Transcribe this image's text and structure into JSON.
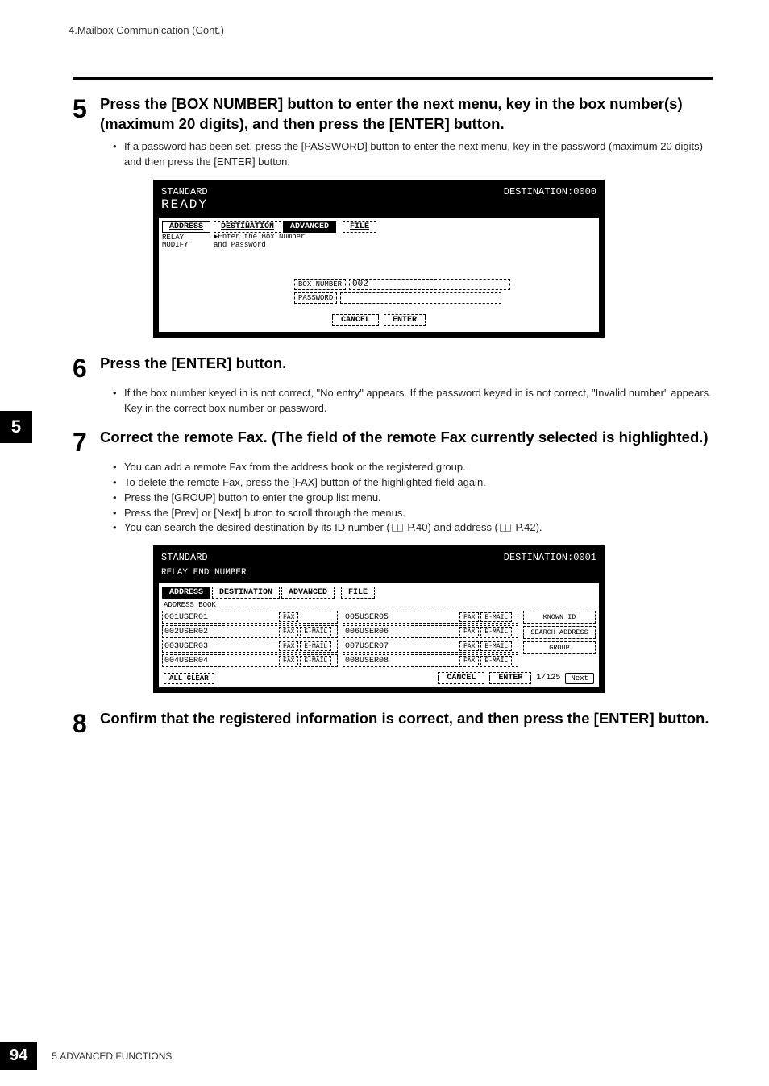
{
  "header": {
    "breadcrumb": "4.Mailbox Communication (Cont.)"
  },
  "chapter_tab": "5",
  "steps": {
    "s5": {
      "num": "5",
      "title": "Press the [BOX NUMBER] button to enter the next menu, key in the box number(s) (maximum 20 digits), and then press the [ENTER] button.",
      "bullets": [
        "If a password has been set, press the [PASSWORD] button to enter the next menu, key in the password (maximum 20 digits) and then press the [ENTER] button."
      ]
    },
    "s6": {
      "num": "6",
      "title": "Press the [ENTER] button.",
      "bullets": [
        "If the box number keyed in is not correct, \"No entry\" appears. If the password keyed in is not correct, \"Invalid number\" appears. Key in the correct box number or password."
      ]
    },
    "s7": {
      "num": "7",
      "title": "Correct the remote Fax. (The field of the remote Fax currently selected is highlighted.)",
      "bullets": [
        "You can add a remote Fax from the address book or the registered group.",
        "To delete the remote Fax, press the [FAX] button of the highlighted field again.",
        "Press the [GROUP] button to enter the group list menu.",
        "Press the [Prev] or [Next] button to scroll through the menus."
      ],
      "bullet_with_refs": {
        "prefix": "You can search the desired destination by its ID number (",
        "ref1": " P.40",
        "mid": ") and address (",
        "ref2": " P.42",
        "suffix": ")."
      }
    },
    "s8": {
      "num": "8",
      "title": "Confirm that the registered information is correct, and then press the [ENTER] button."
    }
  },
  "shot1": {
    "mode": "STANDARD",
    "ready": "READY",
    "dest": "DESTINATION:0000",
    "tabs": {
      "address": "ADDRESS",
      "destination": "DESTINATION",
      "advanced": "ADVANCED",
      "file": "FILE"
    },
    "side": "RELAY\nMODIFY",
    "hint": "▶Enter the Box Number\nand Password",
    "boxnum_label": "BOX NUMBER",
    "boxnum_value": "002",
    "password_label": "PASSWORD",
    "cancel": "CANCEL",
    "enter": "ENTER"
  },
  "shot2": {
    "mode": "STANDARD",
    "sub": "RELAY END NUMBER",
    "dest": "DESTINATION:0001",
    "tabs": {
      "address": "ADDRESS",
      "destination": "DESTINATION",
      "advanced": "ADVANCED",
      "file": "FILE"
    },
    "list_label": "ADDRESS BOOK",
    "entries_left": [
      {
        "id": "001USER01",
        "fax": "FAX"
      },
      {
        "id": "002USER02",
        "fax": "FAX",
        "email": "E-MAIL"
      },
      {
        "id": "003USER03",
        "fax": "FAX",
        "email": "E-MAIL"
      },
      {
        "id": "004USER04",
        "fax": "FAX",
        "email": "E-MAIL"
      }
    ],
    "entries_right": [
      {
        "id": "005USER05",
        "fax": "FAX",
        "email": "E-MAIL"
      },
      {
        "id": "006USER06",
        "fax": "FAX",
        "email": "E-MAIL"
      },
      {
        "id": "007USER07",
        "fax": "FAX",
        "email": "E-MAIL"
      },
      {
        "id": "008USER08",
        "fax": "FAX",
        "email": "E-MAIL"
      }
    ],
    "side_buttons": {
      "known": "KNOWN ID",
      "search": "SEARCH ADDRESS",
      "group": "GROUP"
    },
    "allclear": "ALL CLEAR",
    "cancel": "CANCEL",
    "enter": "ENTER",
    "page": "1/125",
    "next": "Next"
  },
  "footer": {
    "page": "94",
    "text": "5.ADVANCED FUNCTIONS"
  }
}
